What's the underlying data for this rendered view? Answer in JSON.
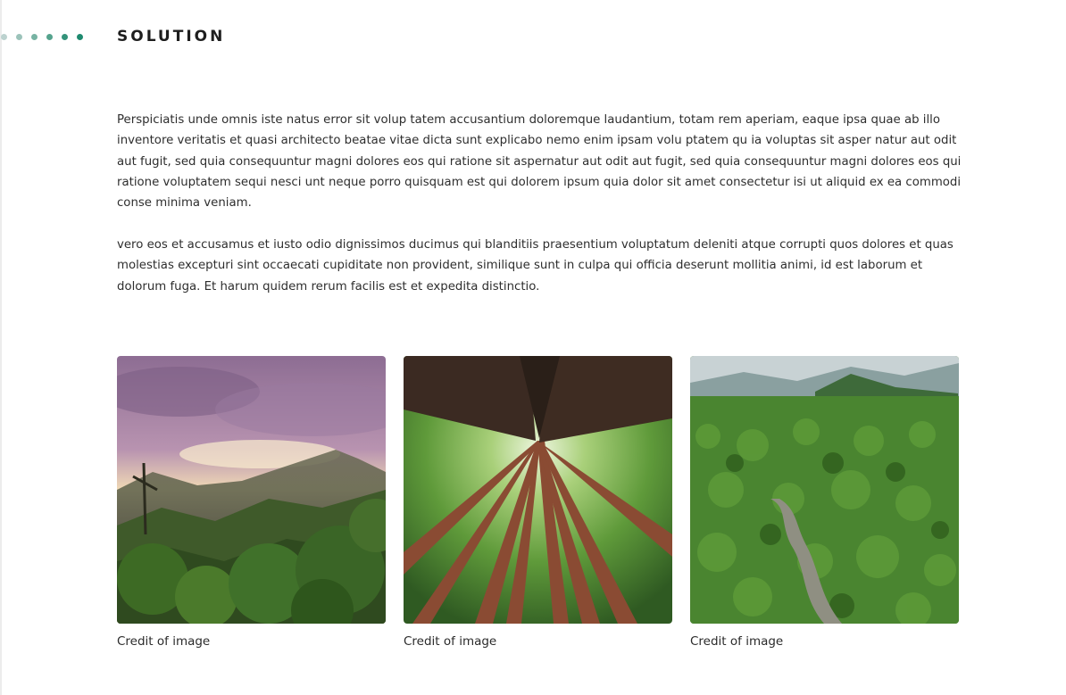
{
  "section": {
    "title": "SOLUTION",
    "dot_colors": [
      "#bcd2cf",
      "#9cc3ba",
      "#77b3a3",
      "#55a38d",
      "#34937a",
      "#1e8a6f"
    ]
  },
  "paragraphs": [
    "Perspiciatis unde omnis iste natus error sit volup tatem accusantium doloremque laudantium, totam rem aperiam, eaque ipsa quae ab illo inventore veritatis et quasi architecto beatae vitae dicta sunt explicabo nemo enim ipsam volu ptatem qu ia voluptas sit asper natur aut odit aut fugit, sed quia consequuntur magni dolores eos qui ratione sit aspernatur aut odit aut fugit, sed quia consequuntur magni dolores eos qui ratione voluptatem sequi nesci unt neque porro quisquam est qui dolorem ipsum quia dolor sit amet consectetur isi ut aliquid ex ea commodi conse minima veniam.",
    "vero eos et accusamus et iusto odio dignissimos ducimus qui blanditiis praesentium voluptatum deleniti atque corrupti quos dolores et quas molestias excepturi sint occaecati cupiditate non provident, similique sunt in culpa qui officia deserunt mollitia animi, id est laborum et dolorum fuga. Et harum quidem rerum facilis est et expedita distinctio."
  ],
  "gallery": [
    {
      "caption": "Credit of image"
    },
    {
      "caption": "Credit of image"
    },
    {
      "caption": "Credit of image"
    }
  ]
}
